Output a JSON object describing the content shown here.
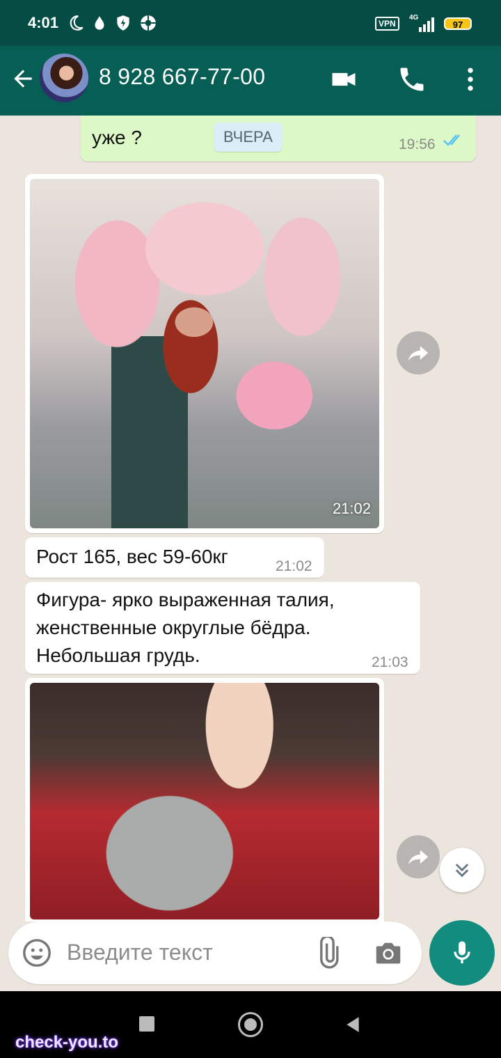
{
  "status_bar": {
    "time": "4:01",
    "vpn": "VPN",
    "network": "4G",
    "battery": "97"
  },
  "header": {
    "contact_name": "8 928 667-77-00",
    "icons": [
      "back-arrow-icon",
      "video-call-icon",
      "voice-call-icon",
      "more-menu-icon"
    ]
  },
  "chat": {
    "date_divider": "ВЧЕРА",
    "messages": [
      {
        "type": "outgoing",
        "text": "уже ?",
        "time": "19:56",
        "status": "read"
      },
      {
        "type": "incoming-photo",
        "time": "21:02"
      },
      {
        "type": "incoming",
        "text": "Рост 165, вес 59-60кг",
        "time": "21:02"
      },
      {
        "type": "incoming",
        "text": "Фигура- ярко выраженная талия, женственные округлые бёдра. Небольшая грудь.",
        "time": "21:03"
      },
      {
        "type": "incoming-photo",
        "time": ""
      }
    ]
  },
  "composer": {
    "placeholder": "Введите текст",
    "icons": [
      "emoji-icon",
      "attach-icon",
      "camera-icon",
      "mic-icon"
    ]
  },
  "colors": {
    "header": "#075e54",
    "statusbar": "#054d44",
    "outgoing": "#dcf8c6",
    "incoming": "#ffffff",
    "accent": "#128c7e",
    "read_ticks": "#4fc3f7"
  },
  "watermark": "check-you.to"
}
